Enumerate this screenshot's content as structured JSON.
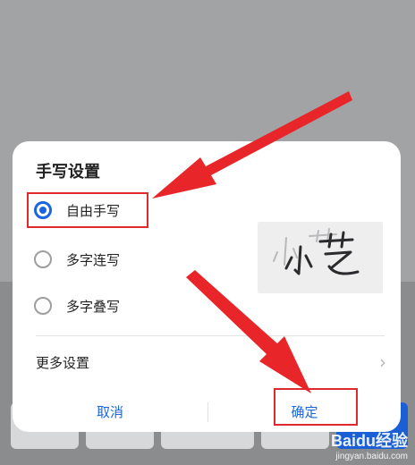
{
  "dialog": {
    "title": "手写设置",
    "options": [
      {
        "label": "自由手写",
        "checked": true
      },
      {
        "label": "多字连写",
        "checked": false
      },
      {
        "label": "多字叠写",
        "checked": false
      }
    ],
    "preview_text": "小艺",
    "more_settings": "更多设置",
    "chevron": "›",
    "cancel": "取消",
    "confirm": "确定"
  },
  "watermark": {
    "main": "Baidu经验",
    "sub": "jingyan.baidu.com"
  },
  "colors": {
    "accent": "#1a66e0",
    "annotation": "#e0292e",
    "backdrop": "#a2a3a5"
  }
}
